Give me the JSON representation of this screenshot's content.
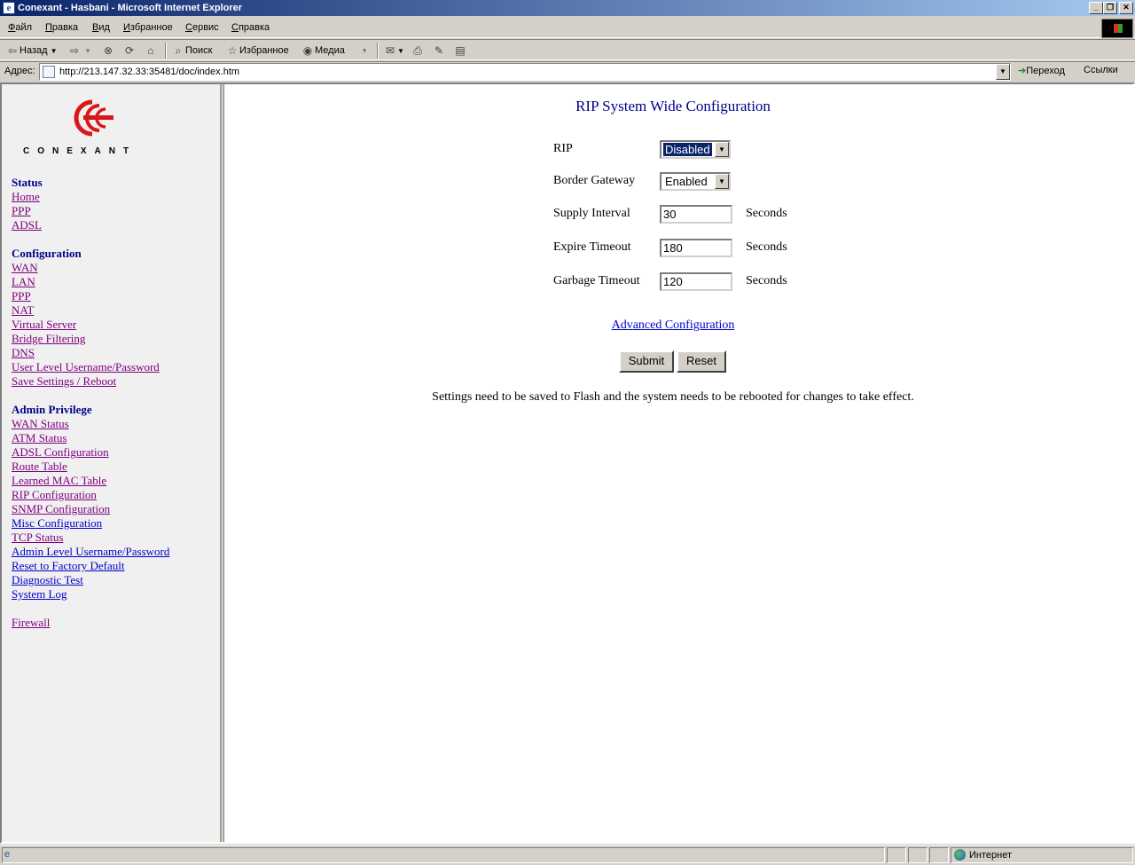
{
  "window": {
    "title": "Conexant - Hasbani - Microsoft Internet Explorer",
    "icon": "ie-icon",
    "controls": [
      "minimize",
      "restore",
      "close"
    ]
  },
  "menu": [
    "Файл",
    "Правка",
    "Вид",
    "Избранное",
    "Сервис",
    "Справка"
  ],
  "toolbar": {
    "back": "Назад",
    "search": "Поиск",
    "favorites": "Избранное",
    "media": "Медиа"
  },
  "address": {
    "label": "Адрес:",
    "url": "http://213.147.32.33:35481/doc/index.htm",
    "go": "Переход",
    "links": "Ссылки"
  },
  "sidebar": {
    "logo_text": "CONEXANT",
    "status": {
      "heading": "Status",
      "links": [
        "Home",
        "PPP",
        "ADSL"
      ]
    },
    "configuration": {
      "heading": "Configuration",
      "links": [
        "WAN",
        "LAN",
        "PPP",
        "NAT",
        "Virtual Server",
        "Bridge Filtering",
        "DNS",
        "User Level Username/Password",
        "Save Settings / Reboot"
      ]
    },
    "admin": {
      "heading": "Admin Privilege",
      "links": [
        "WAN Status",
        "ATM Status",
        "ADSL Configuration",
        "Route Table",
        "Learned MAC Table",
        "RIP Configuration",
        "SNMP Configuration",
        "Misc Configuration",
        "TCP Status",
        "Admin Level Username/Password",
        "Reset to Factory Default",
        "Diagnostic Test",
        "System Log"
      ]
    },
    "firewall": "Firewall"
  },
  "main": {
    "title": "RIP System Wide Configuration",
    "rip_label": "RIP",
    "rip_value": "Disabled",
    "border_gateway_label": "Border Gateway",
    "border_gateway_value": "Enabled",
    "supply_interval_label": "Supply Interval",
    "supply_interval_value": "30",
    "expire_timeout_label": "Expire Timeout",
    "expire_timeout_value": "180",
    "garbage_timeout_label": "Garbage Timeout",
    "garbage_timeout_value": "120",
    "unit": "Seconds",
    "advanced_link": "Advanced Configuration",
    "submit": "Submit",
    "reset": "Reset",
    "note": "Settings need to be saved to Flash and the system needs to be rebooted for changes to take effect."
  },
  "statusbar": {
    "zone": "Интернет"
  }
}
